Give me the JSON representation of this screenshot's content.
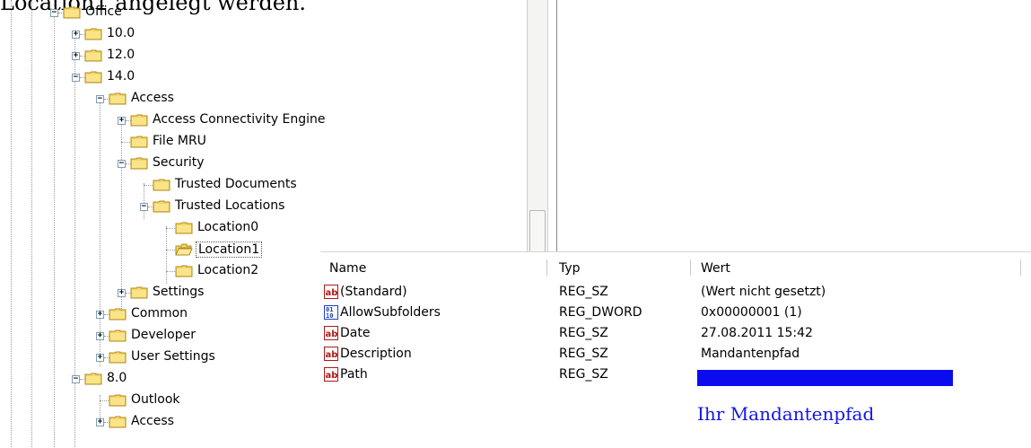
{
  "caption": "Location1 angelegt werden.",
  "tree": {
    "nodes": [
      {
        "label": "Office",
        "state": "expanded"
      },
      {
        "label": "10.0",
        "state": "collapsed"
      },
      {
        "label": "12.0",
        "state": "collapsed"
      },
      {
        "label": "14.0",
        "state": "expanded"
      },
      {
        "label": "Access",
        "state": "expanded"
      },
      {
        "label": "Access Connectivity Engine",
        "state": "collapsed"
      },
      {
        "label": "File MRU",
        "state": "leaf"
      },
      {
        "label": "Security",
        "state": "expanded"
      },
      {
        "label": "Trusted Documents",
        "state": "leaf"
      },
      {
        "label": "Trusted Locations",
        "state": "expanded"
      },
      {
        "label": "Location0",
        "state": "leaf"
      },
      {
        "label": "Location1",
        "state": "leaf",
        "selected": true
      },
      {
        "label": "Location2",
        "state": "leaf"
      },
      {
        "label": "Settings",
        "state": "collapsed"
      },
      {
        "label": "Common",
        "state": "collapsed"
      },
      {
        "label": "Developer",
        "state": "collapsed"
      },
      {
        "label": "User Settings",
        "state": "collapsed"
      },
      {
        "label": "8.0",
        "state": "expanded"
      },
      {
        "label": "Outlook",
        "state": "leaf"
      },
      {
        "label": "Access",
        "state": "collapsed"
      }
    ]
  },
  "values": {
    "columns": {
      "name": "Name",
      "type": "Typ",
      "value": "Wert"
    },
    "rows": [
      {
        "name": "(Standard)",
        "type": "REG_SZ",
        "value": "(Wert nicht gesetzt)",
        "icon": "string-value-icon"
      },
      {
        "name": "AllowSubfolders",
        "type": "REG_DWORD",
        "value": "0x00000001 (1)",
        "icon": "dword-value-icon"
      },
      {
        "name": "Date",
        "type": "REG_SZ",
        "value": "27.08.2011 15:42",
        "icon": "string-value-icon"
      },
      {
        "name": "Description",
        "type": "REG_SZ",
        "value": "Mandantenpfad",
        "icon": "string-value-icon"
      },
      {
        "name": "Path",
        "type": "REG_SZ",
        "value": "",
        "icon": "string-value-icon",
        "redacted": true
      }
    ]
  },
  "annotation": "Ihr Mandantenpfad",
  "colors": {
    "folder": "#f5d86a",
    "folder_border": "#b08a1c",
    "redaction": "#0b0bf0",
    "annotation": "#1515e8"
  }
}
